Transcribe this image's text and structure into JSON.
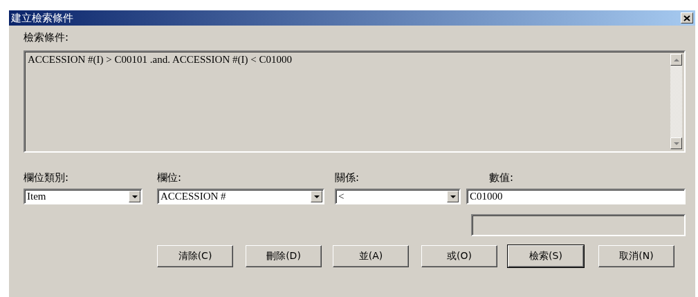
{
  "window": {
    "title": "建立檢索條件"
  },
  "query": {
    "label": "檢索條件:",
    "value": "ACCESSION #(I) > C00101 .and. ACCESSION #(I) < C01000",
    "disabled": true
  },
  "fields": [
    {
      "kind": "combo",
      "label": "欄位類別:",
      "value": "Item"
    },
    {
      "kind": "combo",
      "label": "欄位:",
      "value": "ACCESSION #"
    },
    {
      "kind": "combo",
      "label": "關係:",
      "value": "<"
    },
    {
      "kind": "text",
      "label": "數值:",
      "value": "C01000"
    }
  ],
  "extra_field": {
    "disabled": true
  },
  "buttons": [
    {
      "label": "清除(C)",
      "default": false
    },
    {
      "label": "刪除(D)",
      "default": false
    },
    {
      "label": "並(A)",
      "default": false
    },
    {
      "label": "或(O)",
      "default": false
    },
    {
      "label": "檢索(S)",
      "default": true
    },
    {
      "label": "取消(N)",
      "default": false
    }
  ]
}
